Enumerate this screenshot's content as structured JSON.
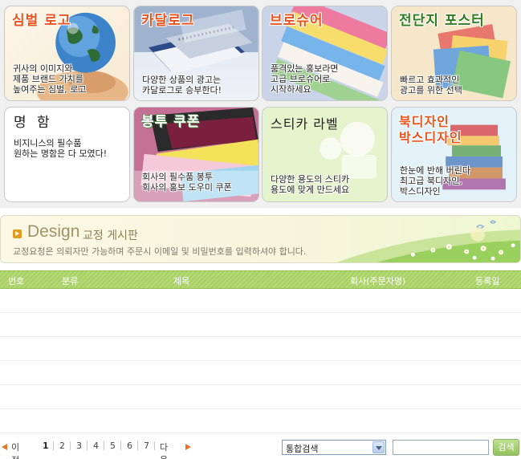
{
  "categories": [
    {
      "title": "심벌 로고",
      "title_color": "#e8541f",
      "desc": "귀사의 이미지와\n제품 브랜드 가치를\n높여주는 심벌, 로고",
      "icon": "globe-hand-icon"
    },
    {
      "title": "카달로그",
      "title_color": "#e8541f",
      "desc": "다양한 상품의 광고는\n카달로그로 승부한다!",
      "icon": "catalog-book-icon"
    },
    {
      "title": "브로슈어",
      "title_color": "#e8541f",
      "desc": "품격있는 홍보라면\n고급 브로슈어로\n시작하세요",
      "icon": "brochure-stack-icon"
    },
    {
      "title": "전단지 포스터",
      "title_color": "#2f7d21",
      "desc": "빠르고 효과적인\n광고를 위한 선택",
      "icon": "flyer-stack-icon"
    },
    {
      "title": "명 함",
      "title_color": "#222222",
      "desc": "비지니스의 필수품\n원하는 명함은 다 모였다!",
      "icon": "business-card-icon"
    },
    {
      "title": "봉투 쿠폰",
      "title_color": "#ffffff",
      "desc": "회사의 필수품 봉투\n회사의 홍보 도우미 쿠폰",
      "icon": "envelope-coupon-icon"
    },
    {
      "title": "스티카 라벨",
      "title_color": "#222222",
      "desc": "다양한 용도의 스티카\n용도에 맞게 만드세요",
      "icon": "sticker-label-icon"
    },
    {
      "title": "북디자인\n박스디자인",
      "title_color": "#e8541f",
      "desc": "한눈에 반해 버린다\n최고급 북디자인,\n박스디자인",
      "icon": "book-stack-icon"
    }
  ],
  "board": {
    "title_en": "Design",
    "title_ko": "교정 게시판",
    "notice": "교정요청은 의뢰자만 가능하며 주문시 이메일 및 비밀번호를 입력하셔야 합니다.",
    "accent": "#e39a1f"
  },
  "table": {
    "columns": [
      "번호",
      "분류",
      "제목",
      "회사(주문자명)",
      "등록일"
    ],
    "header_color": "#a7cf63",
    "rows": [
      "",
      "",
      "",
      "",
      "",
      ""
    ]
  },
  "paging": {
    "prev": "이전",
    "next": "다음",
    "pages": [
      "1",
      "2",
      "3",
      "4",
      "5",
      "6",
      "7"
    ],
    "current": "1",
    "arrow_color": "#e8752a"
  },
  "search": {
    "selected": "통합검색",
    "input_value": "",
    "button": "검색"
  }
}
